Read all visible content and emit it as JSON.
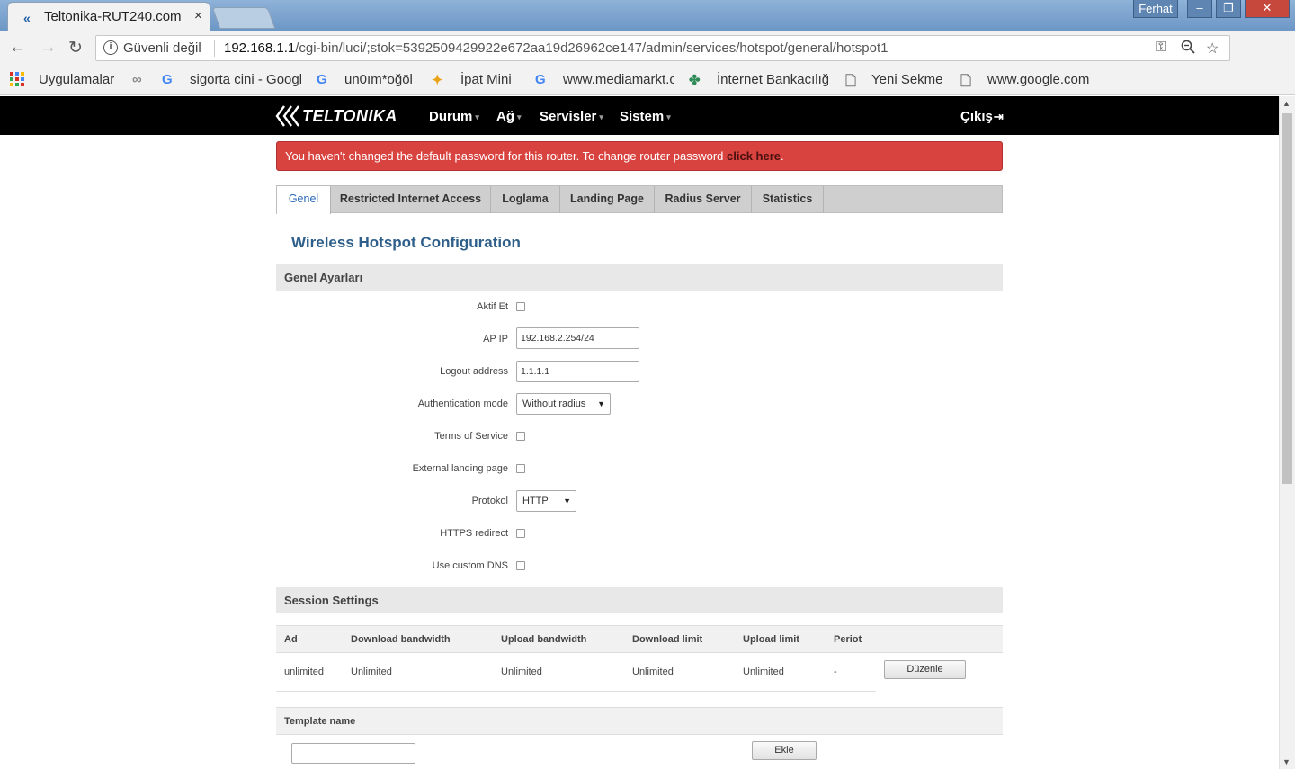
{
  "browser": {
    "tab_title": "Teltonika-RUT240.com",
    "tab_close": "×",
    "user_badge": "Ferhat",
    "win_min": "–",
    "win_max": "❐",
    "win_close": "✕",
    "back": "←",
    "forward": "→",
    "reload": "↻",
    "security_label": "Güvenli değil",
    "url_host": "192.168.1.1",
    "url_path": "/cgi-bin/luci/;stok=5392509429922e672aa19d26962ce147/admin/services/hotspot/general/hotspot1",
    "menu": "⋮"
  },
  "bookmarks": {
    "apps": "Uygulamalar",
    "items": [
      {
        "label": "",
        "icon": "link-icon"
      },
      {
        "label": "sigorta cini - Google",
        "icon": "google-icon"
      },
      {
        "label": "un0ım*oğöl",
        "icon": "google-icon"
      },
      {
        "label": "İpat Mini",
        "icon": "star-burst-icon"
      },
      {
        "label": "www.mediamarkt.com",
        "icon": "google-icon"
      },
      {
        "label": "İnternet Bankacılığı",
        "icon": "clover-icon"
      },
      {
        "label": "Yeni Sekme",
        "icon": "page-icon"
      },
      {
        "label": "www.google.com",
        "icon": "page-icon"
      }
    ]
  },
  "nav": {
    "logo": "TELTONIKA",
    "items": [
      "Durum",
      "Ağ",
      "Servisler",
      "Sistem"
    ],
    "logout": "Çıkış"
  },
  "alert": {
    "text": "You haven't changed the default password for this router. To change router password ",
    "link": "click here",
    "end": "."
  },
  "tabs": [
    "Genel",
    "Restricted Internet Access",
    "Loglama",
    "Landing Page",
    "Radius Server",
    "Statistics"
  ],
  "page_title": "Wireless Hotspot Configuration",
  "general": {
    "heading": "Genel Ayarları",
    "enable_label": "Aktif Et",
    "ap_ip_label": "AP IP",
    "ap_ip_value": "192.168.2.254/24",
    "logout_label": "Logout address",
    "logout_value": "1.1.1.1",
    "auth_label": "Authentication mode",
    "auth_value": "Without radius",
    "tos_label": "Terms of Service",
    "ext_landing_label": "External landing page",
    "protocol_label": "Protokol",
    "protocol_value": "HTTP",
    "https_label": "HTTPS redirect",
    "dns_label": "Use custom DNS"
  },
  "session": {
    "heading": "Session Settings",
    "columns": [
      "Ad",
      "Download bandwidth",
      "Upload bandwidth",
      "Download limit",
      "Upload limit",
      "Periot"
    ],
    "row": [
      "unlimited",
      "Unlimited",
      "Unlimited",
      "Unlimited",
      "Unlimited",
      "-"
    ],
    "edit_button": "Düzenle"
  },
  "template": {
    "heading": "Template name",
    "input_value": "",
    "add_button": "Ekle"
  }
}
